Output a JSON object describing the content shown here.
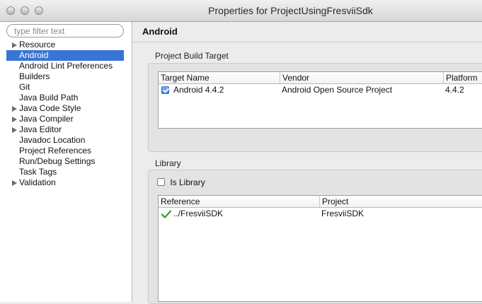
{
  "window": {
    "title": "Properties for ProjectUsingFresviiSdk"
  },
  "sidebar": {
    "filter_placeholder": "type filter text",
    "items": [
      {
        "label": "Resource",
        "expandable": true,
        "selected": false
      },
      {
        "label": "Android",
        "expandable": false,
        "selected": true
      },
      {
        "label": "Android Lint Preferences",
        "expandable": false,
        "selected": false
      },
      {
        "label": "Builders",
        "expandable": false,
        "selected": false
      },
      {
        "label": "Git",
        "expandable": false,
        "selected": false
      },
      {
        "label": "Java Build Path",
        "expandable": false,
        "selected": false
      },
      {
        "label": "Java Code Style",
        "expandable": true,
        "selected": false
      },
      {
        "label": "Java Compiler",
        "expandable": true,
        "selected": false
      },
      {
        "label": "Java Editor",
        "expandable": true,
        "selected": false
      },
      {
        "label": "Javadoc Location",
        "expandable": false,
        "selected": false
      },
      {
        "label": "Project References",
        "expandable": false,
        "selected": false
      },
      {
        "label": "Run/Debug Settings",
        "expandable": false,
        "selected": false
      },
      {
        "label": "Task Tags",
        "expandable": false,
        "selected": false
      },
      {
        "label": "Validation",
        "expandable": true,
        "selected": false
      }
    ]
  },
  "main": {
    "header_title": "Android",
    "build_target": {
      "section_label": "Project Build Target",
      "columns": [
        "Target Name",
        "Vendor",
        "Platform"
      ],
      "rows": [
        {
          "checked": true,
          "name": "Android 4.4.2",
          "vendor": "Android Open Source Project",
          "platform": "4.4.2"
        }
      ]
    },
    "library": {
      "section_label": "Library",
      "is_library_label": "Is Library",
      "is_library_checked": false,
      "columns": [
        "Reference",
        "Project"
      ],
      "rows": [
        {
          "reference": "../FresviiSDK",
          "project": "FresviiSDK"
        }
      ]
    }
  },
  "colors": {
    "selection": "#3875d7",
    "checkmark_green": "#3aa53a"
  }
}
